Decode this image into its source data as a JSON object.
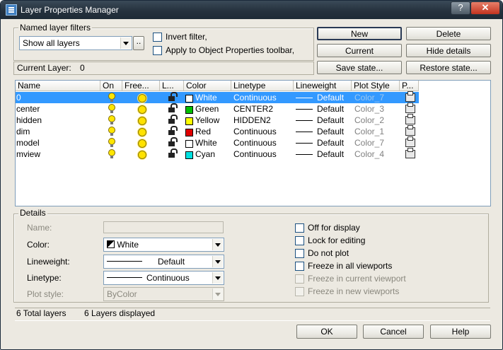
{
  "window": {
    "title": "Layer Properties Manager"
  },
  "filters": {
    "legend": "Named layer filters",
    "selected": "Show all layers",
    "browse": "..",
    "invert_label": "Invert filter,",
    "apply_label": "Apply to Object Properties toolbar,"
  },
  "current_layer": {
    "label": "Current Layer:",
    "value": "0"
  },
  "buttons": {
    "new": "New",
    "delete": "Delete",
    "current": "Current",
    "hide_details": "Hide details",
    "save_state": "Save state...",
    "restore_state": "Restore state...",
    "ok": "OK",
    "cancel": "Cancel",
    "help": "Help"
  },
  "columns": [
    "Name",
    "On",
    "Free...",
    "L...",
    "Color",
    "Linetype",
    "Lineweight",
    "Plot Style",
    "P..."
  ],
  "layers": [
    {
      "name": "0",
      "color": "White",
      "color_hex": "#ffffff",
      "linetype": "Continuous",
      "lineweight": "Default",
      "plot_style": "Color_7",
      "selected": true
    },
    {
      "name": "center",
      "color": "Green",
      "color_hex": "#00c000",
      "linetype": "CENTER2",
      "lineweight": "Default",
      "plot_style": "Color_3",
      "selected": false
    },
    {
      "name": "hidden",
      "color": "Yellow",
      "color_hex": "#ffff00",
      "linetype": "HIDDEN2",
      "lineweight": "Default",
      "plot_style": "Color_2",
      "selected": false
    },
    {
      "name": "dim",
      "color": "Red",
      "color_hex": "#e00000",
      "linetype": "Continuous",
      "lineweight": "Default",
      "plot_style": "Color_1",
      "selected": false
    },
    {
      "name": "model",
      "color": "White",
      "color_hex": "#ffffff",
      "linetype": "Continuous",
      "lineweight": "Default",
      "plot_style": "Color_7",
      "selected": false
    },
    {
      "name": "mview",
      "color": "Cyan",
      "color_hex": "#00e0e0",
      "linetype": "Continuous",
      "lineweight": "Default",
      "plot_style": "Color_4",
      "selected": false
    }
  ],
  "details": {
    "legend": "Details",
    "name_label": "Name:",
    "color_label": "Color:",
    "color_value": "White",
    "lineweight_label": "Lineweight:",
    "lineweight_value": "Default",
    "linetype_label": "Linetype:",
    "linetype_value": "Continuous",
    "plotstyle_label": "Plot style:",
    "plotstyle_value": "ByColor",
    "options": [
      {
        "label": "Off for display",
        "enabled": true
      },
      {
        "label": "Lock for editing",
        "enabled": true
      },
      {
        "label": "Do not plot",
        "enabled": true
      },
      {
        "label": "Freeze in all viewports",
        "enabled": true
      },
      {
        "label": "Freeze in current viewport",
        "enabled": false
      },
      {
        "label": "Freeze in new viewports",
        "enabled": false
      }
    ]
  },
  "status": {
    "total": "6 Total layers",
    "displayed": "6 Layers displayed"
  }
}
